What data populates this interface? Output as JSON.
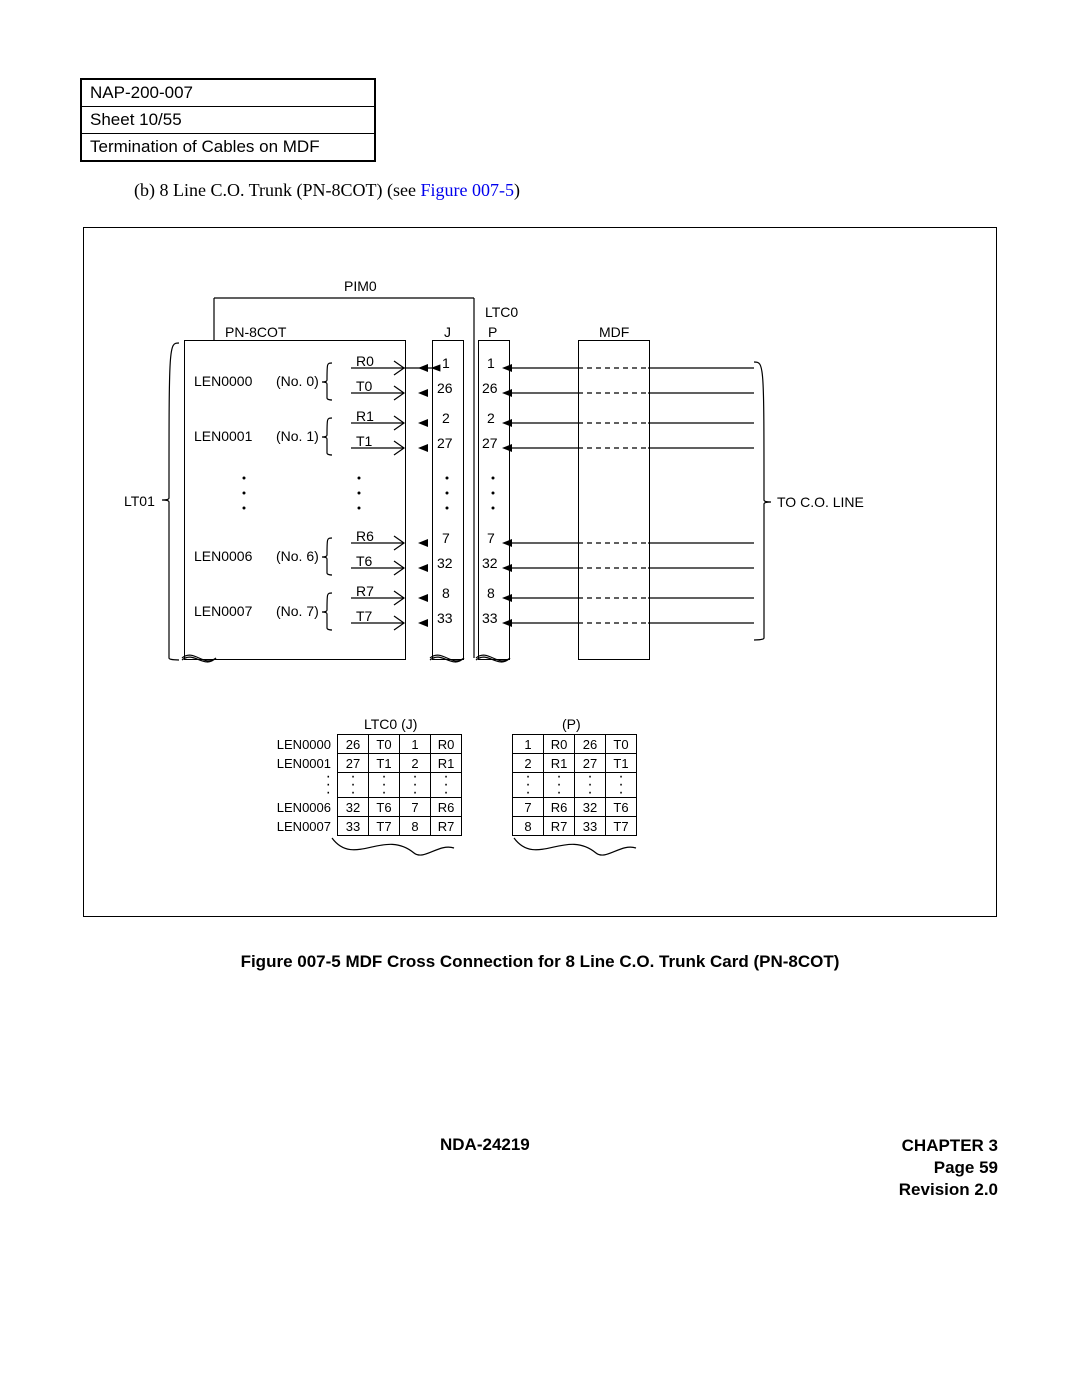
{
  "header": {
    "line1": "NAP-200-007",
    "line2": "Sheet 10/55",
    "line3": "Termination of Cables on MDF"
  },
  "caption_b_prefix": "(b)   8 Line C.O. Trunk (PN-8COT) (see ",
  "caption_b_link": "Figure 007-5",
  "caption_b_suffix": ")",
  "diagram": {
    "pim0": "PIM0",
    "pn8cot": "PN-8COT",
    "ltc0": "LTC0",
    "j": "J",
    "p": "P",
    "mdf": "MDF",
    "lt01": "LT01",
    "tocoline": "TO C.O. LINE",
    "rows": [
      {
        "len": "LEN0000",
        "no": "(No. 0)",
        "r": "R0",
        "t": "T0",
        "rj": "1",
        "tj": "26",
        "rp": "1",
        "tp": "26"
      },
      {
        "len": "LEN0001",
        "no": "(No. 1)",
        "r": "R1",
        "t": "T1",
        "rj": "2",
        "tj": "27",
        "rp": "2",
        "tp": "27"
      },
      {
        "len": "LEN0006",
        "no": "(No. 6)",
        "r": "R6",
        "t": "T6",
        "rj": "7",
        "tj": "32",
        "rp": "7",
        "tp": "32"
      },
      {
        "len": "LEN0007",
        "no": "(No. 7)",
        "r": "R7",
        "t": "T7",
        "rj": "8",
        "tj": "33",
        "rp": "8",
        "tp": "33"
      }
    ],
    "table_j_title": "LTC0 (J)",
    "table_p_title": "(P)",
    "table_j": [
      {
        "len": "LEN0000",
        "a": "26",
        "b": "T0",
        "c": "1",
        "d": "R0"
      },
      {
        "len": "LEN0001",
        "a": "27",
        "b": "T1",
        "c": "2",
        "d": "R1"
      },
      {
        "len": "LEN0006",
        "a": "32",
        "b": "T6",
        "c": "7",
        "d": "R6"
      },
      {
        "len": "LEN0007",
        "a": "33",
        "b": "T7",
        "c": "8",
        "d": "R7"
      }
    ],
    "table_p": [
      {
        "a": "1",
        "b": "R0",
        "c": "26",
        "d": "T0"
      },
      {
        "a": "2",
        "b": "R1",
        "c": "27",
        "d": "T1"
      },
      {
        "a": "7",
        "b": "R6",
        "c": "32",
        "d": "T6"
      },
      {
        "a": "8",
        "b": "R7",
        "c": "33",
        "d": "T7"
      }
    ]
  },
  "figure_caption": "Figure 007-5   MDF Cross Connection for 8 Line C.O. Trunk Card (PN-8COT)",
  "footer": {
    "doc": "NDA-24219",
    "chapter": "CHAPTER 3",
    "page": "Page 59",
    "rev": "Revision 2.0"
  }
}
